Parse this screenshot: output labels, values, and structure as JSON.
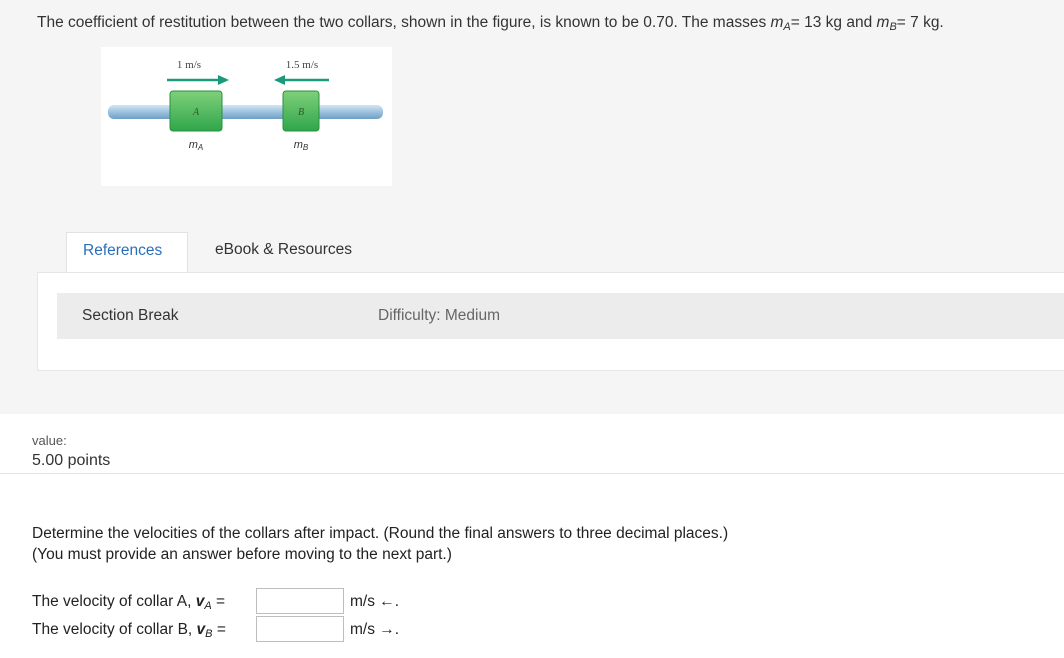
{
  "problem": {
    "text_before_ma": "The coefficient of restitution between the two collars, shown in the figure, is known to be 0.70. The masses ",
    "ma_symbol": "m",
    "ma_sub": "A",
    "ma_value": "= 13 kg and ",
    "mb_symbol": "m",
    "mb_sub": "B",
    "mb_value": "= 7 kg."
  },
  "figure": {
    "velocity_a": "1 m/s",
    "velocity_b": "1.5 m/s",
    "collar_a_letter": "A",
    "collar_b_letter": "B",
    "mass_a_label": "mA",
    "mass_b_label": "mB",
    "colors": {
      "arrow": "#1a9a7a",
      "collar": "#3cb54a",
      "rod": "#a9c9e2"
    }
  },
  "tabs": [
    "References",
    "eBook & Resources"
  ],
  "section": {
    "title": "Section Break",
    "difficulty": "Difficulty: Medium"
  },
  "value": {
    "label": "value:",
    "points": "5.00 points"
  },
  "question": {
    "line1": "Determine the velocities of the collars after impact. (Round the final answers to three decimal places.)",
    "line2": "(You must provide an answer before moving to the next part.)"
  },
  "answers": [
    {
      "label": "The velocity of collar A, ",
      "var": "v",
      "sub": "A",
      "eq": " =",
      "value": "",
      "unit": "m/s ←."
    },
    {
      "label": "The velocity of collar B, ",
      "var": "v",
      "sub": "B",
      "eq": " =",
      "value": "",
      "unit": "m/s →."
    }
  ]
}
